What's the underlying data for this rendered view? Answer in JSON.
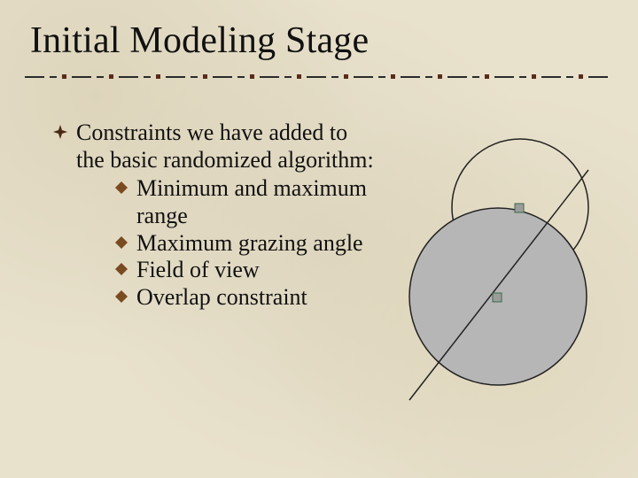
{
  "title": "Initial Modeling Stage",
  "main": "Constraints we have added to the basic randomized algorithm:",
  "subs": {
    "a": "Minimum and maximum range",
    "b": "Maximum grazing angle",
    "c": "Field of view",
    "d": "Overlap constraint"
  }
}
